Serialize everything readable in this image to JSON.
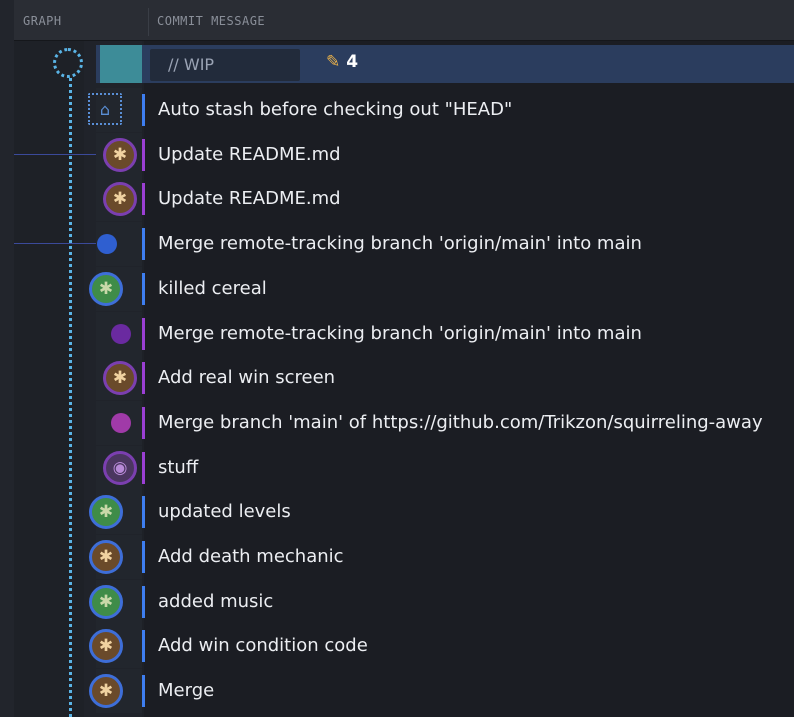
{
  "header": {
    "graph_label": "GRAPH",
    "message_label": "COMMIT MESSAGE"
  },
  "wip": {
    "label": "// WIP",
    "count": "4",
    "pencil": "✎"
  },
  "icons": {
    "stash": "stash-icon",
    "avatar": "avatar-icon",
    "merge_dot": "merge-dot-icon",
    "pencil": "pencil-icon"
  },
  "colors": {
    "blue_lane": "#3e7ef0",
    "purple_lane": "#9b3fd4",
    "graph_line": "#5ab4e6",
    "wip_row": "#2b3d5e"
  },
  "commits": [
    {
      "message": "Auto stash before checking out \"HEAD\"",
      "node": "stash",
      "color": "#3e7ef0"
    },
    {
      "message": "Update README.md",
      "node": "avatar-brown",
      "color": "#9b3fd4"
    },
    {
      "message": "Update README.md",
      "node": "avatar-brown",
      "color": "#9b3fd4"
    },
    {
      "message": "Merge remote-tracking branch 'origin/main' into main",
      "node": "dot-blue",
      "color": "#3e7ef0"
    },
    {
      "message": "killed cereal",
      "node": "avatar-green",
      "color": "#3e7ef0"
    },
    {
      "message": "Merge remote-tracking branch 'origin/main' into main",
      "node": "dot-purple",
      "color": "#9b3fd4"
    },
    {
      "message": "Add real win screen",
      "node": "avatar-brown",
      "color": "#9b3fd4"
    },
    {
      "message": "Merge branch 'main' of https://github.com/Trikzon/squirreling-away",
      "node": "dot-purple2",
      "color": "#9b3fd4"
    },
    {
      "message": "stuff",
      "node": "avatar-purple",
      "color": "#9b3fd4"
    },
    {
      "message": "updated levels",
      "node": "avatar-green",
      "color": "#3e7ef0"
    },
    {
      "message": "Add death mechanic",
      "node": "avatar-brown",
      "color": "#3e7ef0"
    },
    {
      "message": "added music",
      "node": "avatar-green",
      "color": "#3e7ef0"
    },
    {
      "message": "Add win condition code",
      "node": "avatar-brown",
      "color": "#3e7ef0"
    },
    {
      "message": "Merge",
      "node": "avatar-brown",
      "color": "#3e7ef0"
    }
  ]
}
